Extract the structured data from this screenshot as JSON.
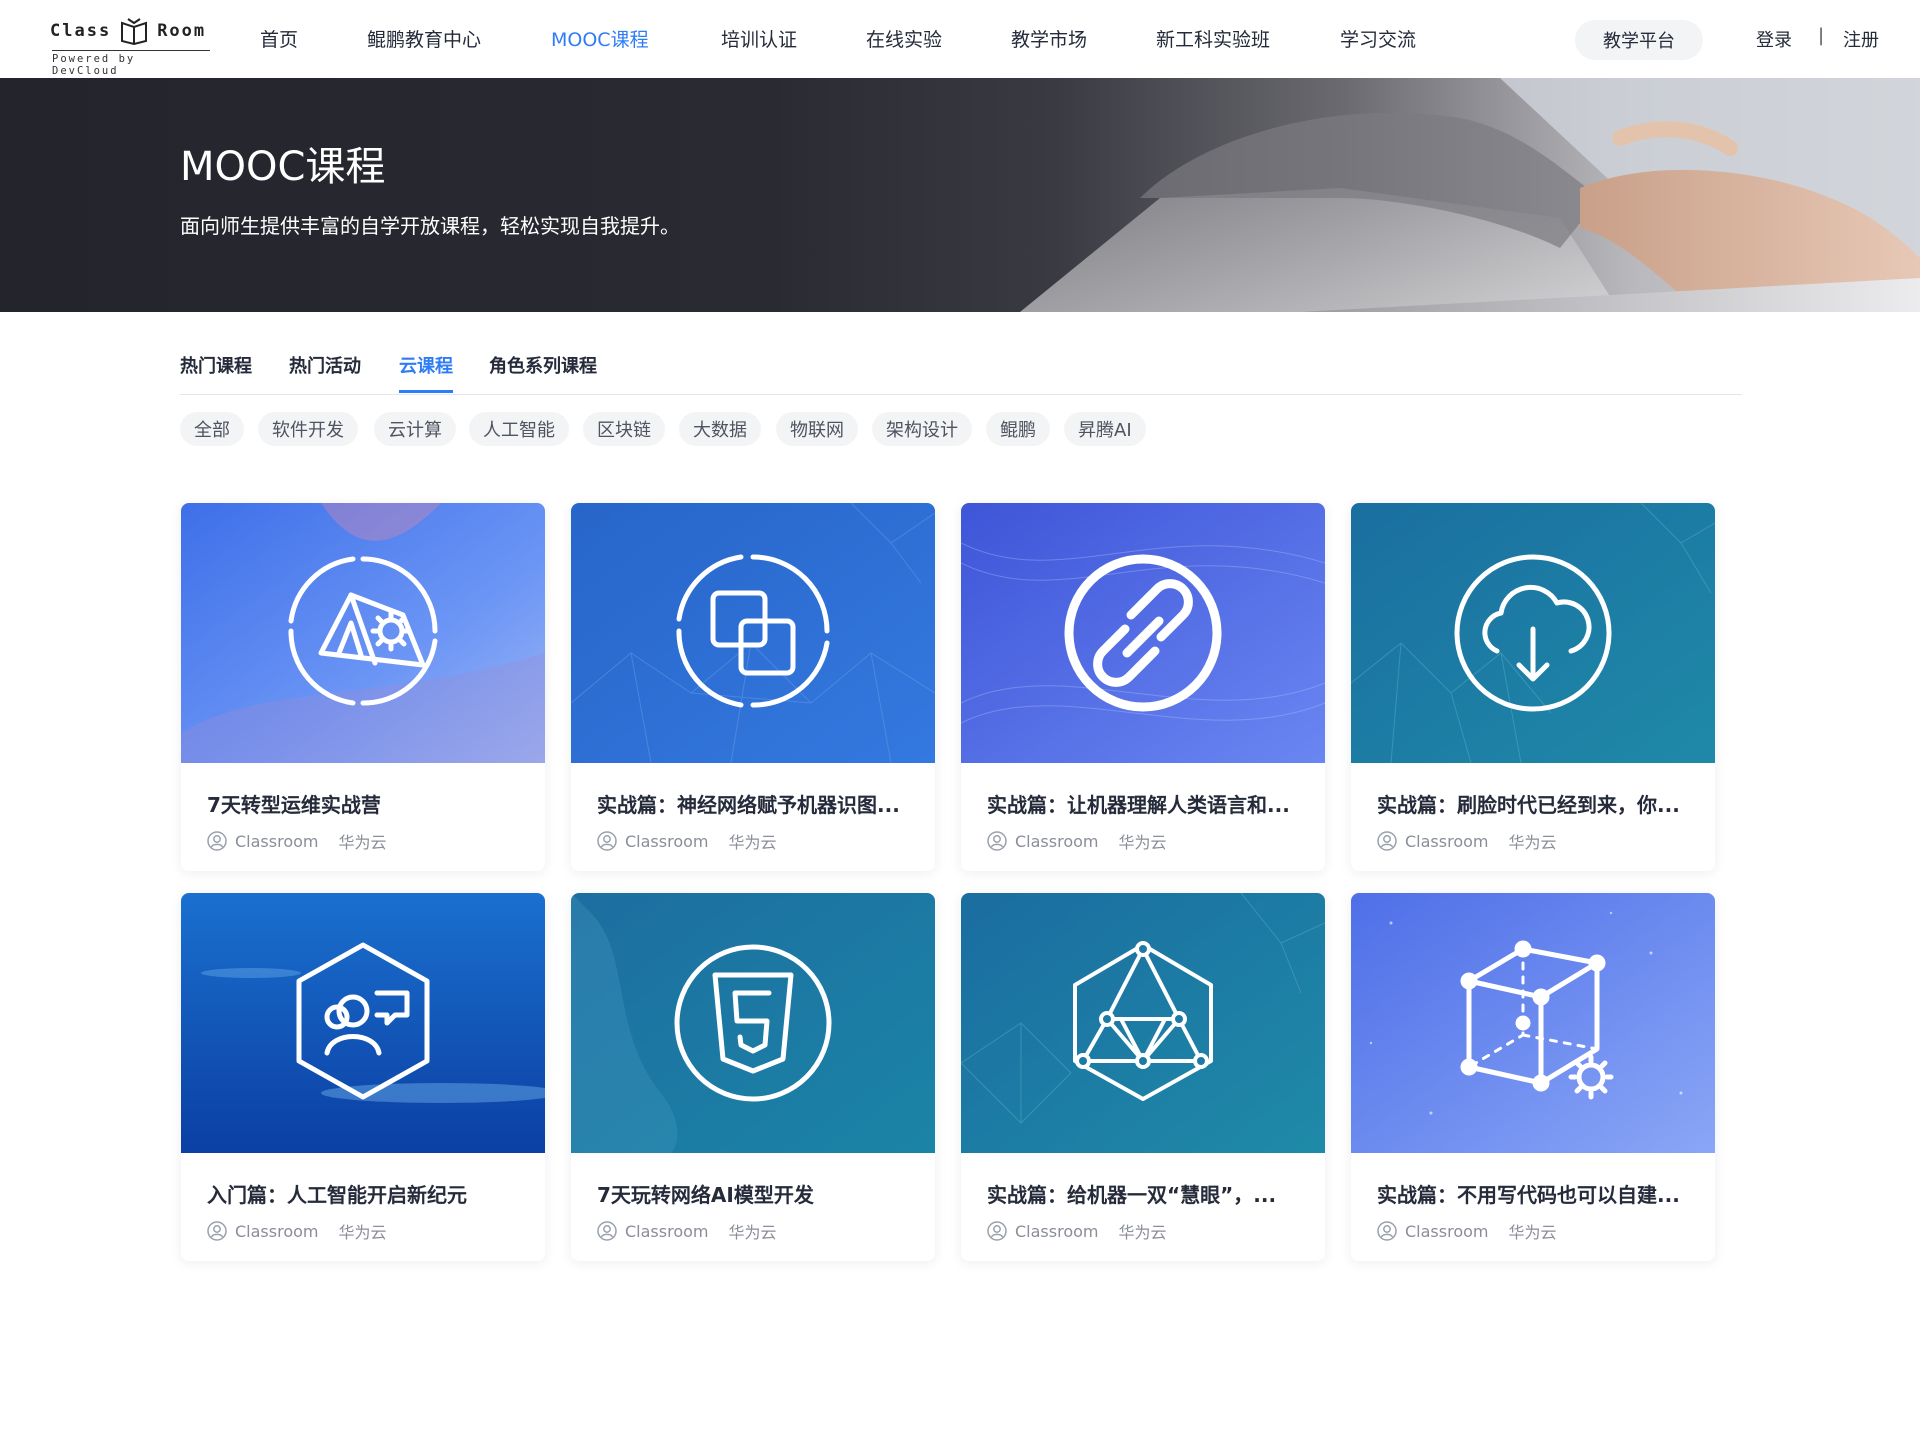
{
  "nav": {
    "logo_word1": "Class",
    "logo_word2": "Room",
    "logo_sub": "Powered by DevCloud",
    "items": [
      "首页",
      "鲲鹏教育中心",
      "MOOC课程",
      "培训认证",
      "在线实验",
      "教学市场",
      "新工科实验班",
      "学习交流"
    ],
    "active": "MOOC课程",
    "platform_button": "教学平台",
    "login": "登录",
    "separator": "|",
    "register": "注册"
  },
  "banner": {
    "title": "MOOC课程",
    "subtitle": "面向师生提供丰富的自学开放课程，轻松实现自我提升。"
  },
  "tabs": {
    "items": [
      "热门课程",
      "热门活动",
      "云课程",
      "角色系列课程"
    ],
    "active": "云课程"
  },
  "filters": [
    "全部",
    "软件开发",
    "云计算",
    "人工智能",
    "区块链",
    "大数据",
    "物联网",
    "架构设计",
    "鲲鹏",
    "昇腾AI"
  ],
  "courses": [
    {
      "title": "7天转型运维实战营",
      "author": "Classroom",
      "source": "华为云",
      "icon": "tent-gear-icon",
      "color": "#4f86f0"
    },
    {
      "title": "实战篇：神经网络赋予机器识图...",
      "author": "Classroom",
      "source": "华为云",
      "icon": "overlap-squares-icon",
      "color": "#2f6fd6"
    },
    {
      "title": "实战篇：让机器理解人类语言和...",
      "author": "Classroom",
      "source": "华为云",
      "icon": "chain-link-icon",
      "color": "#4b62e0"
    },
    {
      "title": "实战篇：刷脸时代已经到来，你...",
      "author": "Classroom",
      "source": "华为云",
      "icon": "cloud-download-icon",
      "color": "#1f7fa8"
    },
    {
      "title": "入门篇：人工智能开启新纪元",
      "author": "Classroom",
      "source": "华为云",
      "icon": "people-chat-icon",
      "color": "#1762c8"
    },
    {
      "title": "7天玩转网络AI模型开发",
      "author": "Classroom",
      "source": "华为云",
      "icon": "html5-icon",
      "color": "#1d78a3"
    },
    {
      "title": "实战篇：给机器一双“慧眼”，...",
      "author": "Classroom",
      "source": "华为云",
      "icon": "network-hexagon-icon",
      "color": "#1e7fa6"
    },
    {
      "title": "实战篇：不用写代码也可以自建...",
      "author": "Classroom",
      "source": "华为云",
      "icon": "cube-gear-icon",
      "color": "#5d7ff0"
    }
  ]
}
